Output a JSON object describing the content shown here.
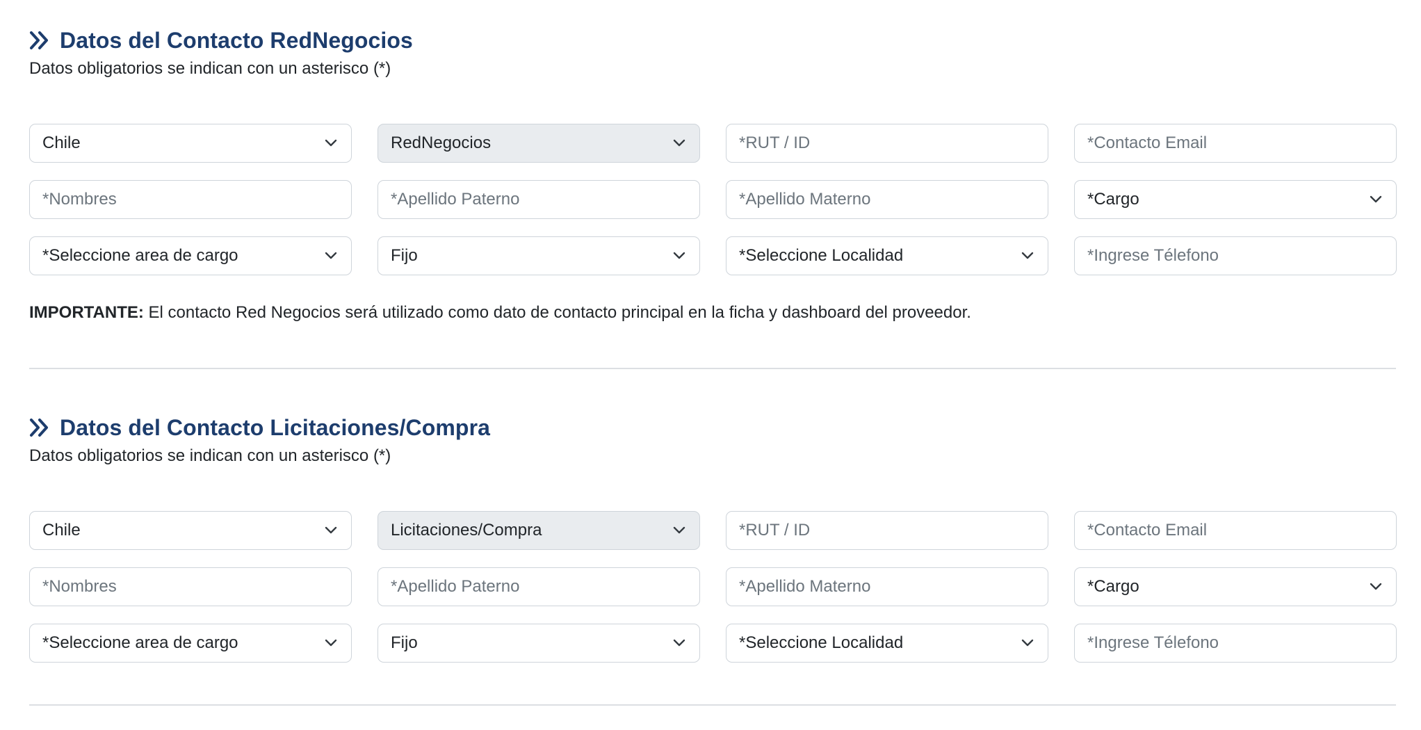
{
  "sections": [
    {
      "title": "Datos del Contacto RedNegocios",
      "subtitle": "Datos obligatorios se indican con un asterisco (*)",
      "country": "Chile",
      "contact_type": "RedNegocios",
      "rut_placeholder": "*RUT / ID",
      "email_placeholder": "*Contacto Email",
      "nombres_placeholder": "*Nombres",
      "apellido_paterno_placeholder": "*Apellido Paterno",
      "apellido_materno_placeholder": "*Apellido Materno",
      "cargo": "*Cargo",
      "area_cargo": "*Seleccione area de cargo",
      "phone_type": "Fijo",
      "localidad": "*Seleccione Localidad",
      "telefono_placeholder": "*Ingrese Télefono",
      "note_bold": "IMPORTANTE:",
      "note_text": " El contacto Red Negocios será utilizado como dato de contacto principal en la ficha y dashboard del proveedor."
    },
    {
      "title": "Datos del Contacto Licitaciones/Compra",
      "subtitle": "Datos obligatorios se indican con un asterisco (*)",
      "country": "Chile",
      "contact_type": "Licitaciones/Compra",
      "rut_placeholder": "*RUT / ID",
      "email_placeholder": "*Contacto Email",
      "nombres_placeholder": "*Nombres",
      "apellido_paterno_placeholder": "*Apellido Paterno",
      "apellido_materno_placeholder": "*Apellido Materno",
      "cargo": "*Cargo",
      "area_cargo": "*Seleccione area de cargo",
      "phone_type": "Fijo",
      "localidad": "*Seleccione Localidad",
      "telefono_placeholder": "*Ingrese Télefono"
    }
  ],
  "icons": {
    "section_icon": "double-chevron-right-icon",
    "select_icon": "chevron-down-icon"
  },
  "colors": {
    "title": "#1d3d6d",
    "border": "#ced4da",
    "disabled_bg": "#e9ecef",
    "placeholder": "#6c757d"
  }
}
